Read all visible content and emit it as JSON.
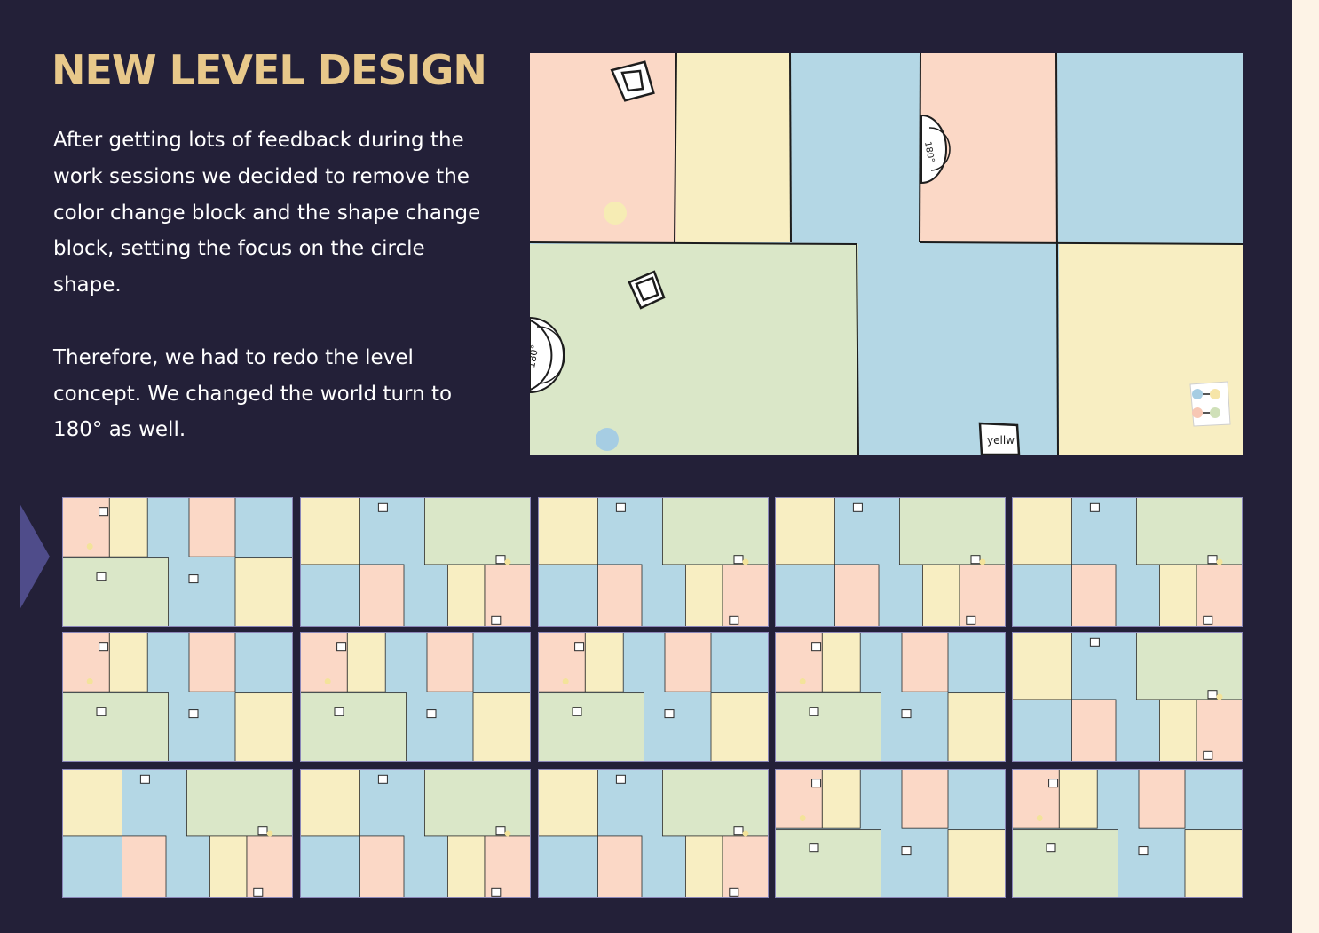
{
  "title": "NEW LEVEL DESIGN",
  "paragraphs": [
    "After getting lots of feedback during the work sessions we decided to remove the color change block and the shape change block, setting the focus on the circle shape.",
    "Therefore, we had to redo the level concept. We changed the world turn to 180° as well."
  ],
  "map": {
    "rotate_labels": [
      "180°",
      "180°"
    ],
    "sign_label": "yellw"
  },
  "colors": {
    "background": "#232038",
    "title": "#e8c88a",
    "pink": "#fbd8c6",
    "yellow": "#f8eec2",
    "blue": "#b4d7e5",
    "green": "#dae7c8",
    "marker": "#4f4c8a"
  },
  "storyboard": {
    "rows": 3,
    "columns": 5,
    "frames": [
      {
        "layout": "A"
      },
      {
        "layout": "B"
      },
      {
        "layout": "B"
      },
      {
        "layout": "B"
      },
      {
        "layout": "B"
      },
      {
        "layout": "A"
      },
      {
        "layout": "A"
      },
      {
        "layout": "A"
      },
      {
        "layout": "A"
      },
      {
        "layout": "B"
      },
      {
        "layout": "B"
      },
      {
        "layout": "B"
      },
      {
        "layout": "B"
      },
      {
        "layout": "A"
      },
      {
        "layout": "A"
      }
    ]
  }
}
